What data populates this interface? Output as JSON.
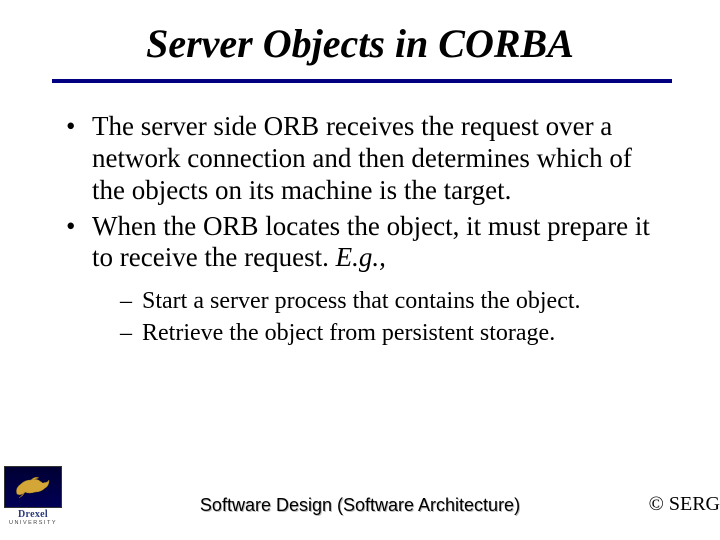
{
  "title": "Server Objects in CORBA",
  "bullets": [
    {
      "text": "The server side ORB receives the request over a network connection and then determines which of the objects on its machine is the target."
    },
    {
      "text": "When the ORB locates the object, it must prepare it to receive the request. ",
      "eg": "E.g.,",
      "subs": [
        "Start a server process that contains the object.",
        "Retrieve the object from persistent storage."
      ]
    }
  ],
  "footer": {
    "center": "Software Design (Software Architecture)",
    "right": "© SERG"
  },
  "logo": {
    "name": "Drexel",
    "sub": "UNIVERSITY"
  }
}
